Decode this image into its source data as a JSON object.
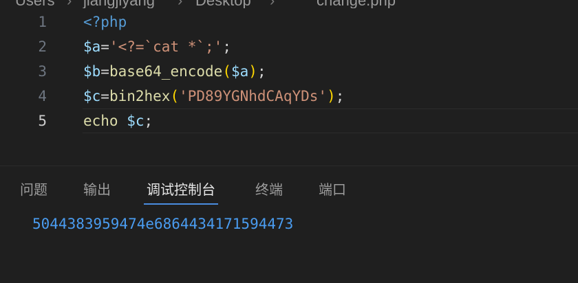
{
  "breadcrumb": {
    "items": [
      "Users",
      "jiangjiyang",
      "Desktop",
      "change.php"
    ],
    "separator": "›"
  },
  "editor": {
    "language": "php",
    "active_line": 5,
    "lines": [
      {
        "number": "1",
        "tokens": [
          [
            "tag",
            "<?php"
          ]
        ]
      },
      {
        "number": "2",
        "tokens": [
          [
            "var",
            "$a"
          ],
          [
            "op",
            "="
          ],
          [
            "str",
            "'<?=`cat *`;'"
          ],
          [
            "punc",
            ";"
          ]
        ]
      },
      {
        "number": "3",
        "tokens": [
          [
            "var",
            "$b"
          ],
          [
            "op",
            "="
          ],
          [
            "fn",
            "base64_encode"
          ],
          [
            "paren",
            "("
          ],
          [
            "var",
            "$a"
          ],
          [
            "paren",
            ")"
          ],
          [
            "punc",
            ";"
          ]
        ]
      },
      {
        "number": "4",
        "tokens": [
          [
            "var",
            "$c"
          ],
          [
            "op",
            "="
          ],
          [
            "fn",
            "bin2hex"
          ],
          [
            "paren",
            "("
          ],
          [
            "str",
            "'PD89YGNhdCAqYDs'"
          ],
          [
            "paren",
            ")"
          ],
          [
            "punc",
            ";"
          ]
        ]
      },
      {
        "number": "5",
        "tokens": [
          [
            "fn",
            "echo"
          ],
          [
            "op",
            " "
          ],
          [
            "var",
            "$c"
          ],
          [
            "punc",
            ";"
          ]
        ]
      }
    ]
  },
  "panel": {
    "tabs": [
      {
        "label": "问题",
        "name": "problems"
      },
      {
        "label": "输出",
        "name": "output"
      },
      {
        "label": "调试控制台",
        "name": "debug-console"
      },
      {
        "label": "终端",
        "name": "terminal"
      },
      {
        "label": "端口",
        "name": "ports"
      }
    ],
    "active_tab": "debug-console",
    "output_text": "5044383959474e6864434171594473"
  },
  "colors": {
    "background": "#1f1f1f",
    "keyword_tag": "#569cd6",
    "variable": "#9cdcfe",
    "string": "#ce9178",
    "function": "#dcdcaa",
    "bracket": "#ffd700",
    "console_output": "#4a9cf0",
    "active_tab_underline": "#4a8de0"
  }
}
